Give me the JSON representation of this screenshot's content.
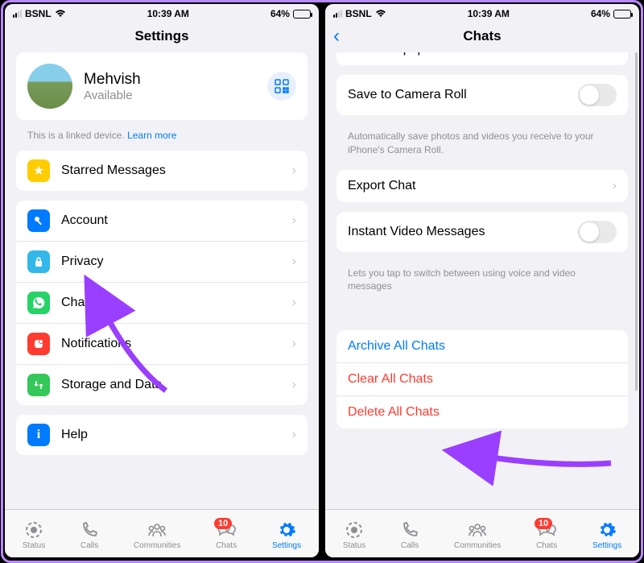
{
  "statusBar": {
    "carrier": "BSNL",
    "time": "10:39 AM",
    "battery": "64%"
  },
  "left": {
    "title": "Settings",
    "profile": {
      "name": "Mehvish",
      "status": "Available"
    },
    "footnote": {
      "text": "This is a linked device. ",
      "link": "Learn more"
    },
    "starred": "Starred Messages",
    "menu": {
      "account": "Account",
      "privacy": "Privacy",
      "chats": "Chats",
      "notifications": "Notifications",
      "storage": "Storage and Data"
    },
    "help": "Help"
  },
  "right": {
    "title": "Chats",
    "wallpaper": "Chat Wallpaper",
    "saveCam": {
      "label": "Save to Camera Roll",
      "note": "Automatically save photos and videos you receive to your iPhone's Camera Roll."
    },
    "export": "Export Chat",
    "ivm": {
      "label": "Instant Video Messages",
      "note": "Lets you tap to switch between using voice and video messages"
    },
    "actions": {
      "archive": "Archive All Chats",
      "clear": "Clear All Chats",
      "del": "Delete All Chats"
    }
  },
  "tabs": {
    "status": "Status",
    "calls": "Calls",
    "communities": "Communities",
    "chats": "Chats",
    "settings": "Settings",
    "chatsBadge": "10"
  }
}
